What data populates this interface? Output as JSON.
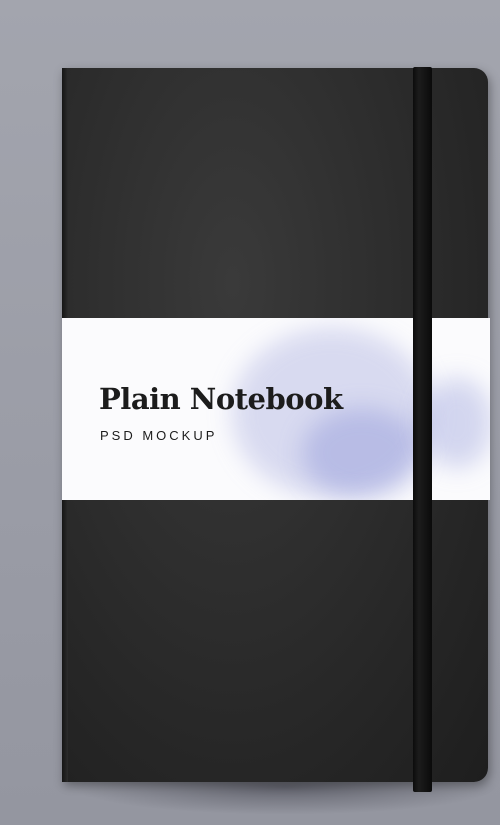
{
  "label": {
    "title": "Plain Notebook",
    "subtitle": "PSD MOCKUP"
  },
  "colors": {
    "background": "#9c9ea8",
    "cover": "#262626",
    "band": "#fbfbfd",
    "wash": "#7d86d0"
  }
}
